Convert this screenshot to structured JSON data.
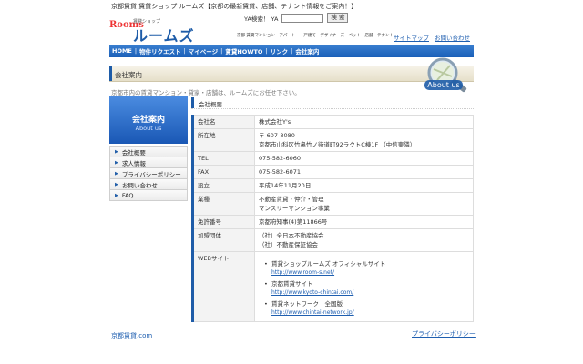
{
  "header": {
    "site_title": "京都賃貸 賃貸ショップ ルームズ【京都の最新賃貸、店舗、テナント情報をご案内！】",
    "logo_sub": "賃貸ショップ",
    "logo_main": "ルームズ",
    "logo_badge": "Rooms",
    "search_label": "YA検索！ YA",
    "search_value": "",
    "search_button": "検 索",
    "tagline": "京都 賃貸マンション・アパート・一戸建て・デザイナーズ・ペット・店舗・テナント",
    "links": [
      "サイトマップ",
      "お問い合わせ"
    ]
  },
  "nav": [
    "HOME",
    "物件リクエスト",
    "マイページ",
    "賃貸HOWTO",
    "リンク",
    "会社案内"
  ],
  "section": {
    "title": "会社案内",
    "intro": "京都市内の賃貸マンション・貸家・店舗は、ルームズにお任せ下さい。",
    "badge": "About us"
  },
  "sidebar": {
    "hero_title": "会社案内",
    "hero_sub": "About us",
    "items": [
      "会社概要",
      "求人情報",
      "プライバシーポリシー",
      "お問い合わせ",
      "FAQ"
    ]
  },
  "company": {
    "heading": "会社概要",
    "rows": [
      {
        "label": "会社名",
        "value": "株式会社Y's"
      },
      {
        "label": "所在地",
        "value": "〒 607-8080",
        "value2": "京都市山科区竹鼻竹ノ街道町92ラクトC棟1F （中信東隣）"
      },
      {
        "label": "TEL",
        "value": "075-582-6060"
      },
      {
        "label": "FAX",
        "value": "075-582-6071"
      },
      {
        "label": "設立",
        "value": "平成14年11月20日"
      },
      {
        "label": "業種",
        "value": "不動産賃貸・仲介・管理",
        "value2": "マンスリーマンション事業"
      },
      {
        "label": "免許番号",
        "value": "京都府知事(4)第11866号"
      },
      {
        "label": "加盟団体",
        "value": "（社）全日本不動産協会",
        "value2": "（社）不動産保証協会"
      }
    ],
    "web_label": "WEBサイト",
    "sites": [
      {
        "name": "賃貸ショップルームズ オフィシャルサイト",
        "url": "http://www.room-s.net/"
      },
      {
        "name": "京都賃貸サイト",
        "url": "http://www.kyoto-chintai.com/"
      },
      {
        "name": "賃貸ネットワーク　全国版",
        "url": "http://www.chintai-network.jp/"
      }
    ]
  },
  "footer": {
    "left": "京都賃貸.com",
    "right": "プライバシーポリシー"
  },
  "colors": {
    "accent": "#1e5ca8",
    "link": "#1f5fb0"
  }
}
